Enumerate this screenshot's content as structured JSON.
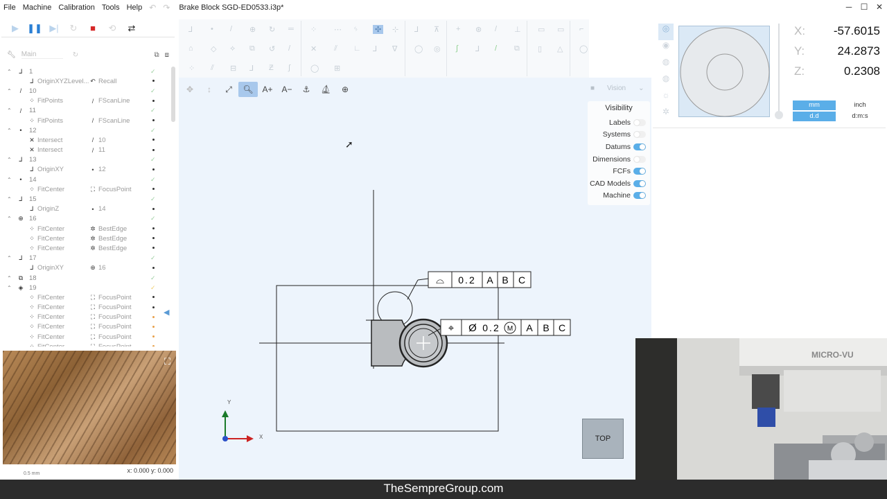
{
  "menu": {
    "items": [
      "File",
      "Machine",
      "Calibration",
      "Tools",
      "Help"
    ],
    "undo_icon": "undo-icon",
    "redo_icon": "redo-icon",
    "title": "Brake Block SGD-ED0533.i3p*",
    "window_controls": [
      "─",
      "☐",
      "✕"
    ]
  },
  "run_toolbar": {
    "icons": [
      "play-icon",
      "pause-icon",
      "step-icon",
      "reset-icon",
      "stop-icon",
      "loop-icon",
      "auto-icon"
    ],
    "colors": {
      "pause": "#2a7fd4",
      "stop": "#d62828",
      "disabled": "#b9d3ec"
    }
  },
  "program_tree": {
    "routine_placeholder": "Main",
    "rows": [
      {
        "type": "step",
        "num": "1",
        "icon": "origin-icon"
      },
      {
        "type": "child",
        "icon": "origin-icon",
        "name": "OriginXYZLevel...",
        "ref_icon": "recall-icon",
        "ref": "Recall"
      },
      {
        "type": "step",
        "num": "10",
        "icon": "line-icon"
      },
      {
        "type": "child",
        "icon": "fit-icon",
        "name": "FitPoints",
        "ref_icon": "line-icon",
        "ref": "FScanLine"
      },
      {
        "type": "step",
        "num": "11",
        "icon": "line-icon"
      },
      {
        "type": "child",
        "icon": "fit-icon",
        "name": "FitPoints",
        "ref_icon": "line-icon",
        "ref": "FScanLine"
      },
      {
        "type": "step",
        "num": "12",
        "icon": "point-icon"
      },
      {
        "type": "child",
        "icon": "intersect-icon",
        "name": "Intersect",
        "ref_icon": "line-icon",
        "ref": "10"
      },
      {
        "type": "child",
        "icon": "intersect-icon",
        "name": "Intersect",
        "ref_icon": "line-icon",
        "ref": "11"
      },
      {
        "type": "step",
        "num": "13",
        "icon": "origin-icon"
      },
      {
        "type": "child",
        "icon": "origin-icon",
        "name": "OriginXY",
        "ref_icon": "point-icon",
        "ref": "12"
      },
      {
        "type": "step",
        "num": "14",
        "icon": "point-icon"
      },
      {
        "type": "child",
        "icon": "fit-icon",
        "name": "FitCenter",
        "ref_icon": "focus-icon",
        "ref": "FocusPoint"
      },
      {
        "type": "step",
        "num": "15",
        "icon": "origin-icon"
      },
      {
        "type": "child",
        "icon": "origin-icon",
        "name": "OriginZ",
        "ref_icon": "point-icon",
        "ref": "14"
      },
      {
        "type": "step",
        "num": "16",
        "icon": "circle-cross-icon"
      },
      {
        "type": "child",
        "icon": "fit-icon",
        "name": "FitCenter",
        "ref_icon": "bestedge-icon",
        "ref": "BestEdge"
      },
      {
        "type": "child",
        "icon": "fit-icon",
        "name": "FitCenter",
        "ref_icon": "bestedge-icon",
        "ref": "BestEdge"
      },
      {
        "type": "child",
        "icon": "fit-icon",
        "name": "FitCenter",
        "ref_icon": "bestedge-icon",
        "ref": "BestEdge"
      },
      {
        "type": "step",
        "num": "17",
        "icon": "origin-icon"
      },
      {
        "type": "child",
        "icon": "origin-icon",
        "name": "OriginXY",
        "ref_icon": "circle-cross-icon",
        "ref": "16"
      },
      {
        "type": "step",
        "num": "18",
        "icon": "datum-icon"
      },
      {
        "type": "step",
        "num": "19",
        "icon": "plane-icon"
      },
      {
        "type": "child",
        "icon": "fit-icon",
        "name": "FitCenter",
        "ref_icon": "focus-icon",
        "ref": "FocusPoint"
      },
      {
        "type": "child",
        "icon": "fit-icon",
        "name": "FitCenter",
        "ref_icon": "focus-icon",
        "ref": "FocusPoint"
      },
      {
        "type": "child",
        "icon": "fit-icon",
        "name": "FitCenter",
        "ref_icon": "focus-icon",
        "ref": "FocusPoint"
      },
      {
        "type": "child",
        "icon": "fit-icon",
        "name": "FitCenter",
        "ref_icon": "focus-icon",
        "ref": "FocusPoint"
      },
      {
        "type": "child",
        "icon": "fit-icon",
        "name": "FitCenter",
        "ref_icon": "focus-icon",
        "ref": "FocusPoint"
      },
      {
        "type": "child",
        "icon": "fit-icon",
        "name": "FitCenter",
        "ref_icon": "focus-icon",
        "ref": "FocusPoint"
      }
    ]
  },
  "video": {
    "scale_label": "0.5 mm",
    "coords": "x: 0.000 y: 0.000"
  },
  "view_toolbar": {
    "icons": [
      "pan-icon",
      "vertical-pan-icon",
      "fit-view-icon",
      "zoom-icon",
      "text-larger-icon",
      "text-smaller-icon",
      "view-icon-1",
      "view-icon-2",
      "view-icon-3"
    ],
    "text_larger": "A+",
    "text_smaller": "A−"
  },
  "vision": {
    "label": "Vision"
  },
  "visibility": {
    "title": "Visibility",
    "items": [
      {
        "label": "Labels",
        "on": false
      },
      {
        "label": "Systems",
        "on": false
      },
      {
        "label": "Datums",
        "on": true
      },
      {
        "label": "Dimensions",
        "on": false
      },
      {
        "label": "FCFs",
        "on": true
      },
      {
        "label": "CAD Models",
        "on": true
      },
      {
        "label": "Machine",
        "on": true
      }
    ]
  },
  "fcf": {
    "profile": {
      "symbol": "⌓",
      "tolerance": "0.2",
      "datums": [
        "A",
        "B",
        "C"
      ]
    },
    "position": {
      "symbol": "⌖",
      "diameter": "Ø",
      "tolerance": "0.2",
      "modifier": "M",
      "datums": [
        "A",
        "B",
        "C"
      ]
    }
  },
  "axes": {
    "x": "X",
    "y": "Y"
  },
  "view_button": "TOP",
  "dro": {
    "rows": [
      {
        "axis": "X:",
        "value": "-57.6015"
      },
      {
        "axis": "Y:",
        "value": "24.2873"
      },
      {
        "axis": "Z:",
        "value": "0.2308"
      }
    ],
    "units": {
      "mm": "mm",
      "inch": "inch",
      "dd": "d.d",
      "dms": "d:m:s"
    }
  },
  "camera_inset": {
    "brand": "MICRO-VU"
  },
  "footer": "TheSempreGroup.com"
}
